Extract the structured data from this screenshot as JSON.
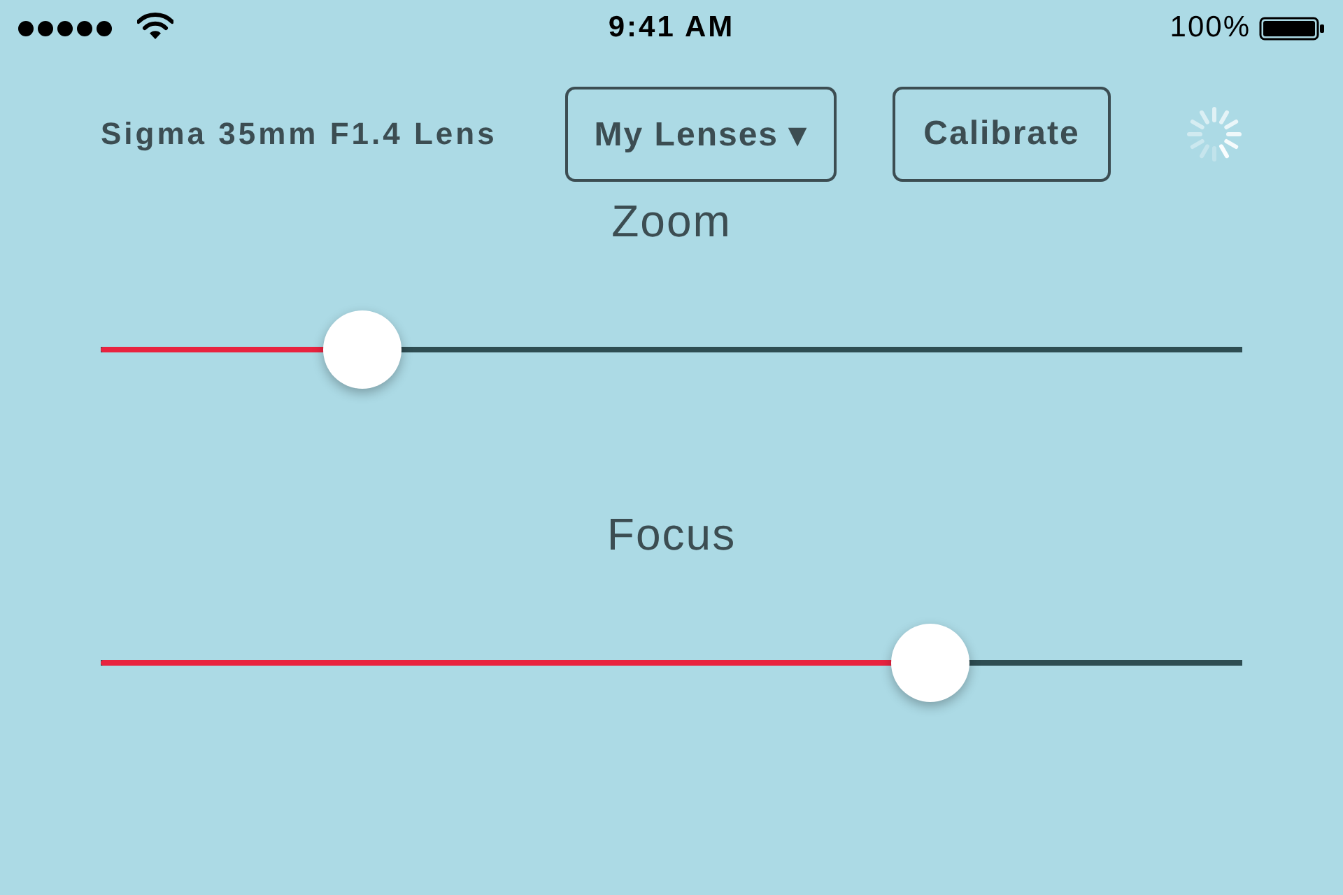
{
  "status_bar": {
    "time": "9:41 AM",
    "battery": "100%"
  },
  "header": {
    "lens_name": "Sigma 35mm F1.4 Lens",
    "buttons": [
      {
        "label": "My Lenses ▾"
      },
      {
        "label": "Calibrate"
      }
    ],
    "loading": true
  },
  "sliders": [
    {
      "label": "Zoom",
      "level": 0.229
    },
    {
      "label": "Focus",
      "level": 0.727
    }
  ]
}
